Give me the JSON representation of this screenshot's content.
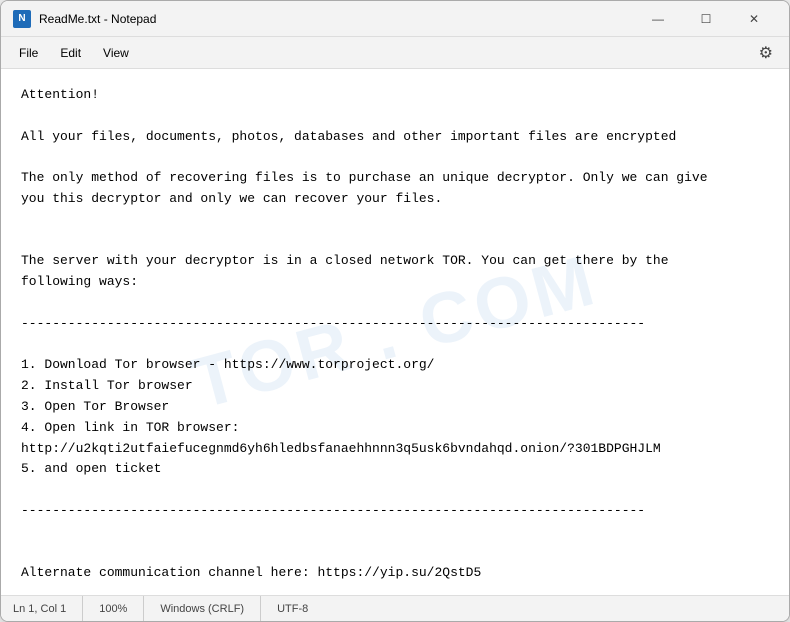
{
  "window": {
    "title": "ReadMe.txt - Notepad",
    "icon_label": "N"
  },
  "title_bar": {
    "minimize_label": "—",
    "maximize_label": "☐",
    "close_label": "✕"
  },
  "menu": {
    "file_label": "File",
    "edit_label": "Edit",
    "view_label": "View",
    "gear_symbol": "⚙"
  },
  "watermark": {
    "text": "TOR . COM"
  },
  "content": {
    "text": "Attention!\n\nAll your files, documents, photos, databases and other important files are encrypted\n\nThe only method of recovering files is to purchase an unique decryptor. Only we can give\nyou this decryptor and only we can recover your files.\n\n\nThe server with your decryptor is in a closed network TOR. You can get there by the\nfollowing ways:\n\n--------------------------------------------------------------------------------\n\n1. Download Tor browser - https://www.torproject.org/\n2. Install Tor browser\n3. Open Tor Browser\n4. Open link in TOR browser:\nhttp://u2kqti2utfaiefucegnmd6yh6hledbsfanaehhnnn3q5usk6bvndahqd.onion/?301BDPGHJLM\n5. and open ticket\n\n--------------------------------------------------------------------------------\n\n\nAlternate communication channel here: https://yip.su/2QstD5"
  },
  "status_bar": {
    "position": "Ln 1, Col 1",
    "zoom": "100%",
    "line_ending": "Windows (CRLF)",
    "encoding": "UTF-8"
  }
}
